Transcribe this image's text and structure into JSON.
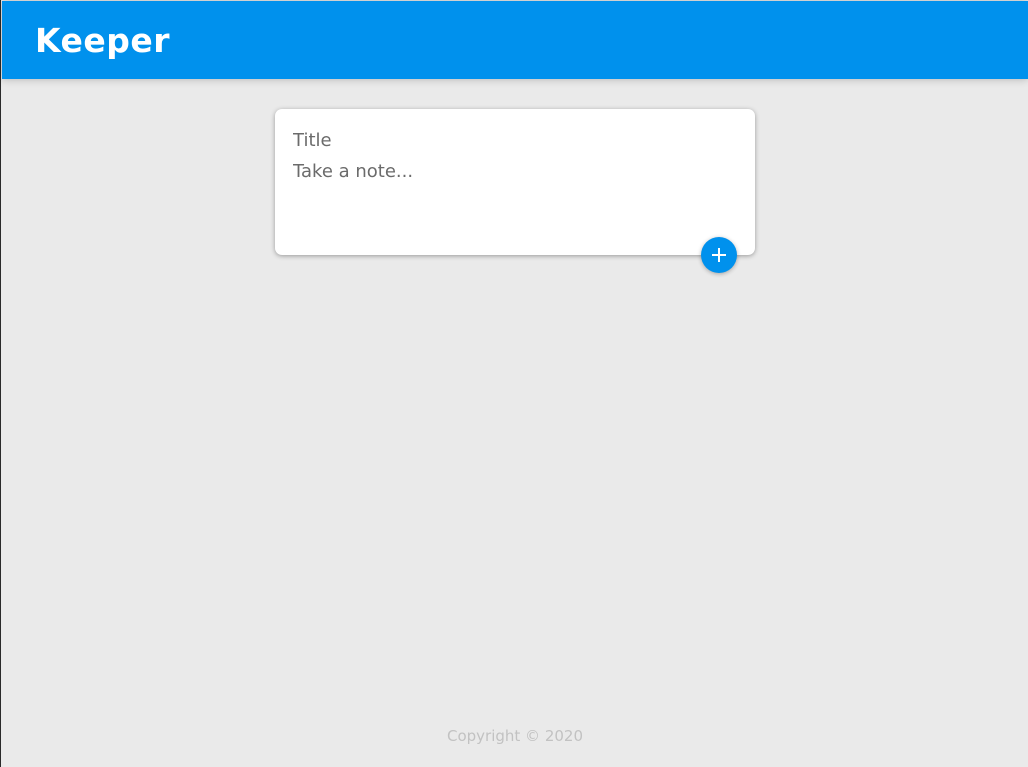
{
  "header": {
    "title": "Keeper"
  },
  "note_form": {
    "title_placeholder": "Title",
    "content_placeholder": "Take a note...",
    "add_button_icon": "plus-icon"
  },
  "footer": {
    "copyright": "Copyright © 2020"
  },
  "colors": {
    "accent": "#0091ed",
    "background": "#eaeaea",
    "footer_text": "#c2c2c2"
  }
}
